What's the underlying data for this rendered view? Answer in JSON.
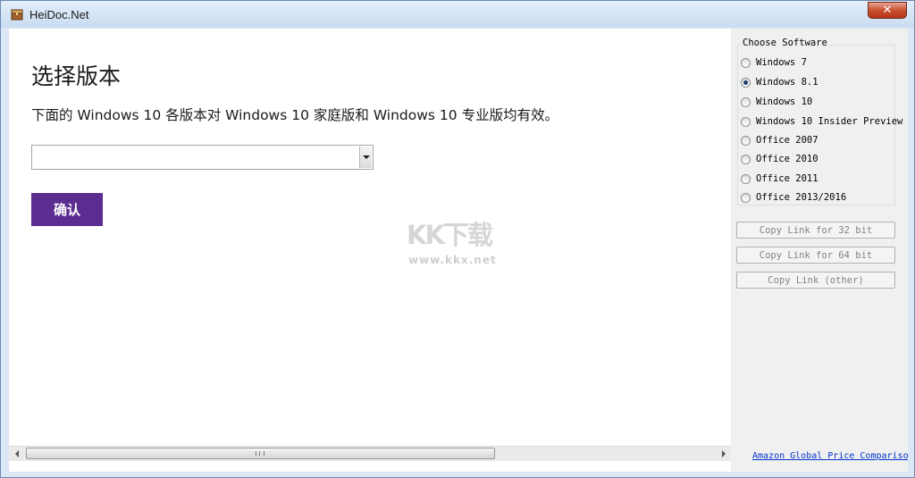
{
  "window": {
    "title": "HeiDoc.Net",
    "close_glyph": "✕"
  },
  "page": {
    "title": "选择版本",
    "description": "下面的 Windows 10 各版本对 Windows 10 家庭版和 Windows 10 专业版均有效。",
    "select_value": "",
    "confirm_label": "确认"
  },
  "watermark": {
    "logo": "KK下载",
    "url": "www.kkx.net"
  },
  "sidebar": {
    "group_label": "Choose Software",
    "options": [
      {
        "label": "Windows 7",
        "checked": false
      },
      {
        "label": "Windows 8.1",
        "checked": true
      },
      {
        "label": "Windows 10",
        "checked": false
      },
      {
        "label": "Windows 10 Insider Preview",
        "checked": false
      },
      {
        "label": "Office 2007",
        "checked": false
      },
      {
        "label": "Office 2010",
        "checked": false
      },
      {
        "label": "Office 2011",
        "checked": false
      },
      {
        "label": "Office 2013/2016",
        "checked": false
      }
    ],
    "buttons": [
      {
        "label": "Copy Link for 32 bit"
      },
      {
        "label": "Copy Link for 64 bit"
      },
      {
        "label": "Copy Link (other)"
      }
    ],
    "amazon_link": "Amazon Global Price Compariso"
  }
}
